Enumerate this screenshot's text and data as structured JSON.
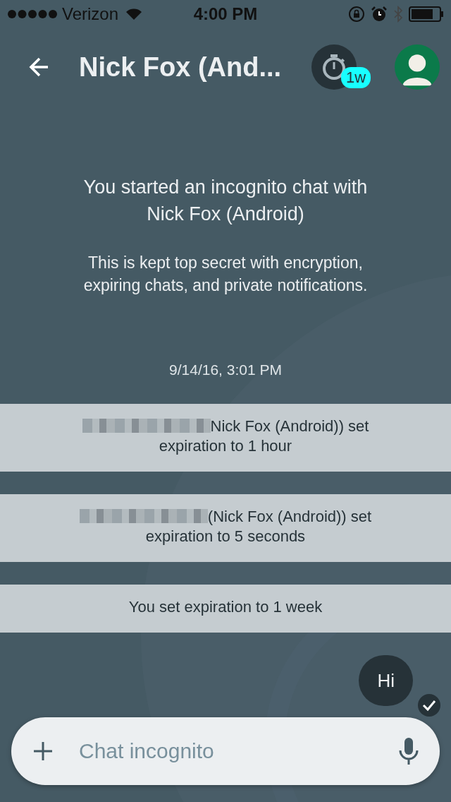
{
  "status_bar": {
    "carrier": "Verizon",
    "time": "4:00 PM"
  },
  "header": {
    "title": "Nick Fox (And...",
    "timer_badge": "1w"
  },
  "intro": {
    "title": "You started an incognito chat with Nick Fox (Android)",
    "subtitle": "This is kept top secret with encryption, expiring chats, and private notifications."
  },
  "date": "9/14/16, 3:01 PM",
  "notices": [
    {
      "text": "Nick Fox (Android)) set expiration to 1 hour",
      "redacted": true
    },
    {
      "text": "(Nick Fox (Android)) set expiration to 5 seconds",
      "redacted": true
    },
    {
      "text": "You set expiration to 1 week",
      "redacted": false
    }
  ],
  "messages": [
    {
      "text": "Hi",
      "delivered": true
    }
  ],
  "composer": {
    "placeholder": "Chat incognito"
  }
}
